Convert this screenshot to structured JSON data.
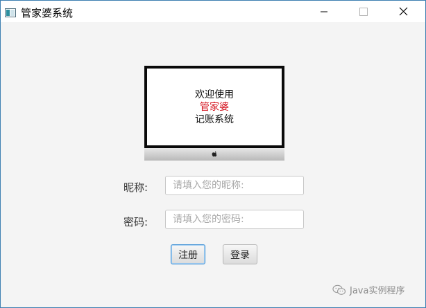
{
  "window": {
    "title": "管家婆系统"
  },
  "monitor": {
    "lines": [
      "欢迎使用",
      "管家婆",
      "记账系统"
    ],
    "highlight_color": "#d4111c"
  },
  "form": {
    "nickname_label": "昵称:",
    "nickname_placeholder": "请填入您的昵称:",
    "nickname_value": "",
    "password_label": "密码:",
    "password_placeholder": "请填入您的密码:",
    "password_value": ""
  },
  "buttons": {
    "register": "注册",
    "login": "登录"
  },
  "watermark": {
    "text": "Java实例程序"
  },
  "colors": {
    "window_border": "#3c7fb1",
    "focus_blue": "#3d8fd4"
  }
}
